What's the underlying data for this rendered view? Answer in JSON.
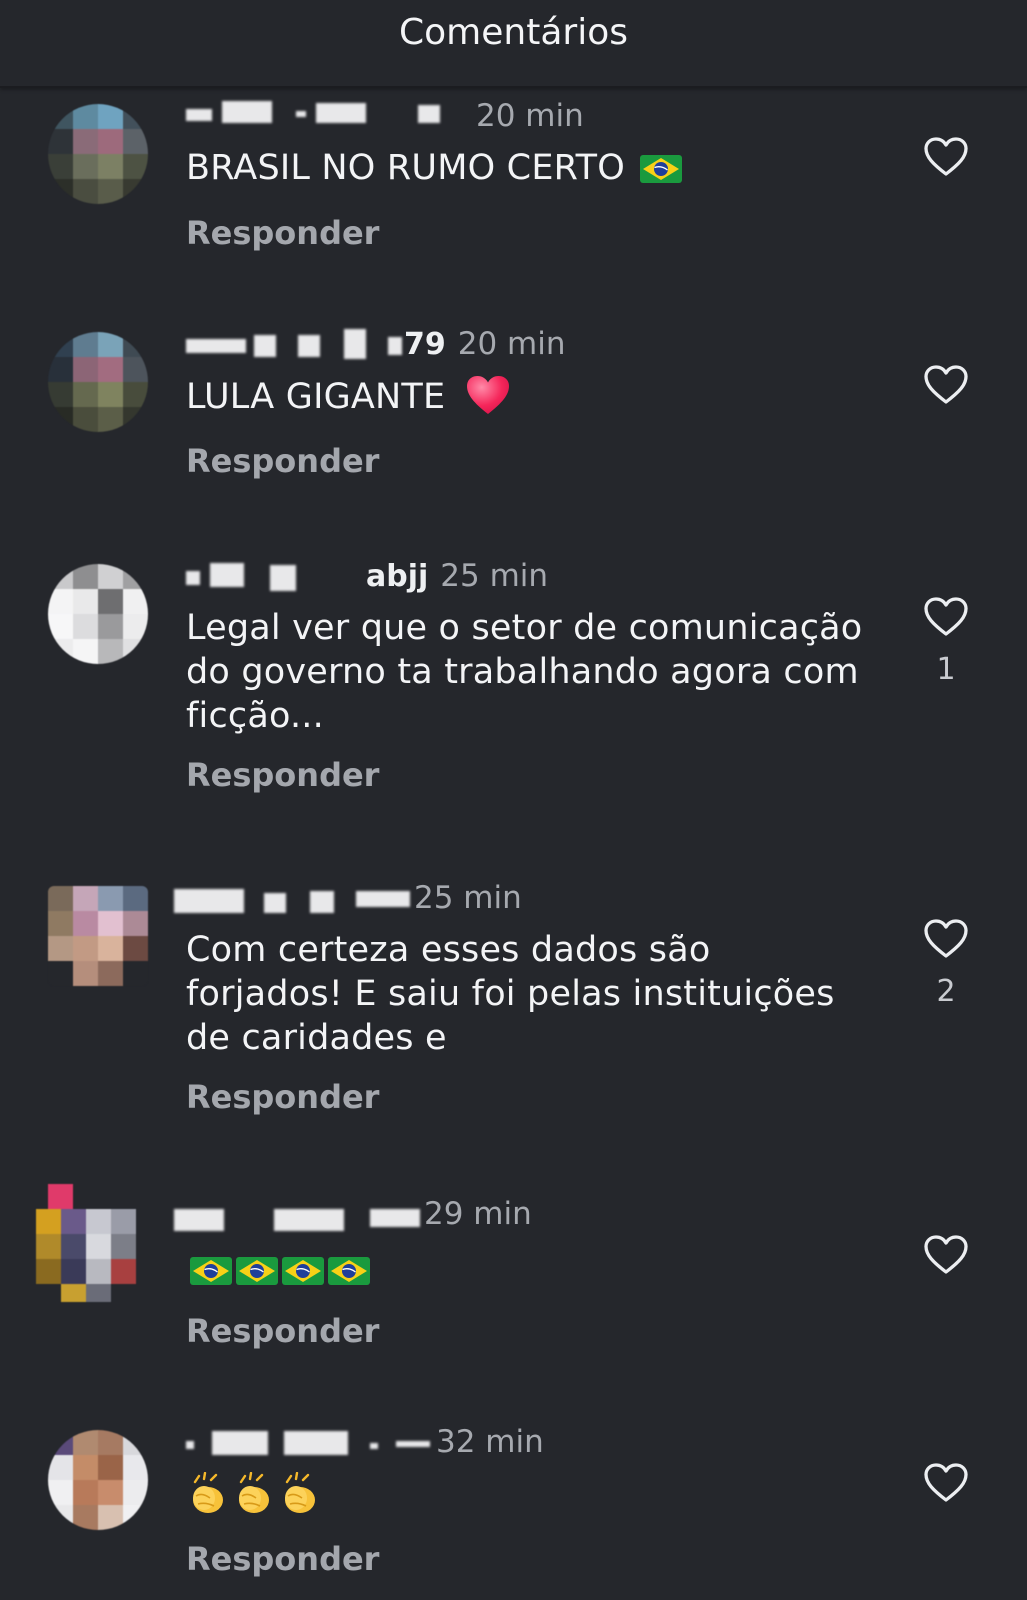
{
  "header": {
    "title": "Comentários"
  },
  "colors": {
    "background": "#25272c",
    "text": "#f3f4f6",
    "muted": "#a6a9af",
    "reply": "#a4a7ad"
  },
  "icons": {
    "like": "heart-outline-icon",
    "flag": "brazil-flag-emoji",
    "heart": "red-heart-emoji",
    "clap": "clapping-hands-emoji"
  },
  "comments": [
    {
      "handle_tail": "",
      "time": "20 min",
      "text": "BRASIL NO RUMO CERTO",
      "reply_label": "Responder",
      "likes": ""
    },
    {
      "handle_tail": "79",
      "time": "20 min",
      "text": "LULA GIGANTE",
      "reply_label": "Responder",
      "likes": ""
    },
    {
      "handle_tail": "abjj",
      "time": "25 min",
      "text": "Legal ver que o setor de comunicação do governo ta trabalhando agora com ficção...",
      "reply_label": "Responder",
      "likes": "1"
    },
    {
      "handle_tail": "",
      "time": "25 min",
      "text": "Com certeza esses dados são forjados! E saiu foi pelas instituições de caridades e",
      "reply_label": "Responder",
      "likes": "2"
    },
    {
      "handle_tail": "",
      "time": "29 min",
      "text": "",
      "reply_label": "Responder",
      "likes": ""
    },
    {
      "handle_tail": "",
      "time": "32 min",
      "text": "",
      "reply_label": "Responder",
      "likes": ""
    }
  ]
}
